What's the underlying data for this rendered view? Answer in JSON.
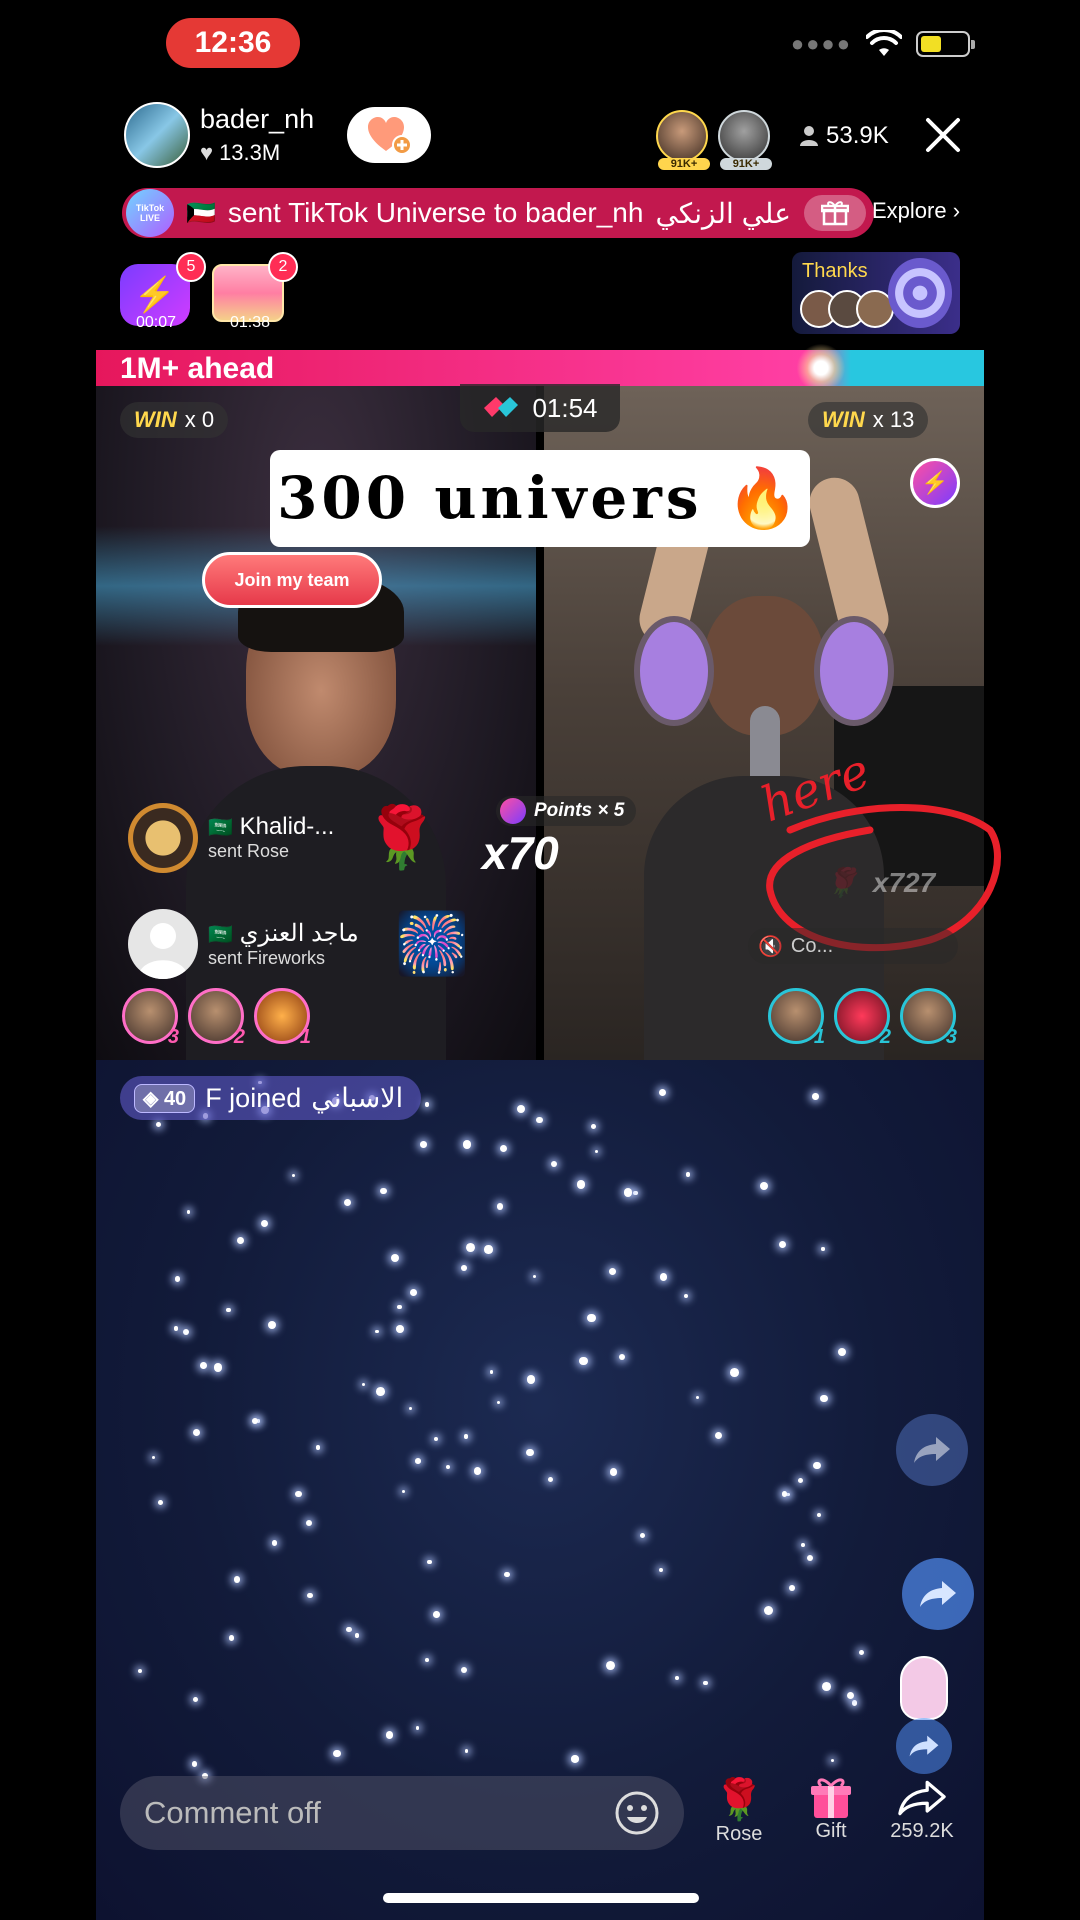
{
  "status_bar": {
    "time": "12:36",
    "battery_level": 0.45
  },
  "header": {
    "username": "bader_nh",
    "likes": "13.3M",
    "top_gifters": [
      {
        "badge": "91K+"
      },
      {
        "badge": "91K+"
      }
    ],
    "viewer_count": "53.9K"
  },
  "banner": {
    "live_label": "TikTok LIVE",
    "flag": "🇰🇼",
    "message": "sent TikTok Universe to bader_nh",
    "sender": "علي الزنكي",
    "explore": "Explore"
  },
  "boxes": [
    {
      "count": "5",
      "timer": "00:07"
    },
    {
      "count": "2",
      "timer": "01:38"
    }
  ],
  "thanks": {
    "label": "Thanks"
  },
  "battle": {
    "lead_text": "1M+ ahead",
    "left_win_word": "WIN",
    "left_win_count": "x 0",
    "right_win_word": "WIN",
    "right_win_count": "x 13",
    "timer": "01:54",
    "caption": "300  univers  🔥",
    "join_team": "Join my team",
    "points_label": "Points × 5",
    "multiplier": "x70",
    "annotation_word": "here",
    "annotation_count": "x727",
    "muted_label": "Co..."
  },
  "gift_feed": [
    {
      "flag": "🇸🇦",
      "name": "Khalid-...",
      "action": "sent Rose",
      "gift_icon": "🌹"
    },
    {
      "flag": "🇸🇦",
      "name": "ماجد العنزي",
      "action": "sent Fireworks",
      "gift_icon": "🎆"
    }
  ],
  "left_ranks": [
    "3",
    "2",
    "1"
  ],
  "right_ranks": [
    "1",
    "2",
    "3"
  ],
  "joined": {
    "level": "40",
    "text": "F joined",
    "name": "الاسباني"
  },
  "bottom_bar": {
    "comment_placeholder": "Comment off",
    "rose_label": "Rose",
    "gift_label": "Gift",
    "share_count": "259.2K"
  }
}
